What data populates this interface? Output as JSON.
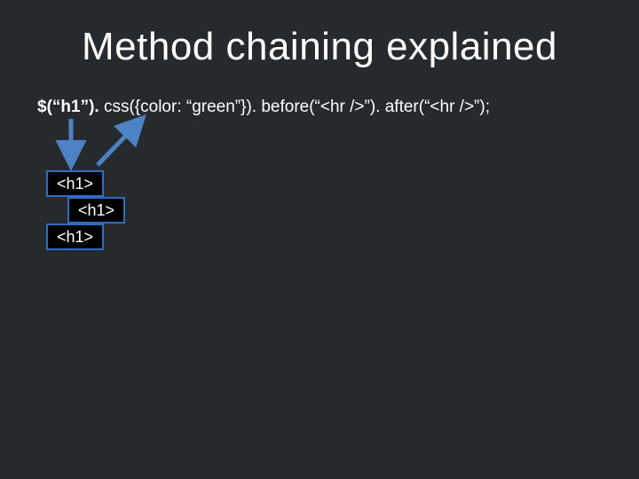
{
  "title": "Method chaining explained",
  "code": {
    "seg_bold": "$(“h1”).",
    "seg_rest": " css({color: “green”}). before(“<hr />”). after(“<hr />”);"
  },
  "boxes": {
    "b1": "<h1>",
    "b2": "<h1>",
    "b3": "<h1>"
  },
  "colors": {
    "background": "#262a2d",
    "box_border": "#2f6cc3",
    "arrow": "#4d83c4"
  }
}
